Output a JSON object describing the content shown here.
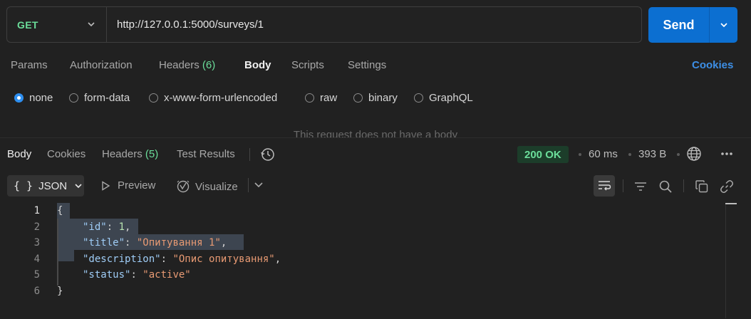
{
  "request": {
    "method": "GET",
    "url": "http://127.0.0.1:5000/surveys/1",
    "send_label": "Send"
  },
  "request_tabs": [
    {
      "label": "Params"
    },
    {
      "label": "Authorization"
    },
    {
      "label": "Headers",
      "count": "(6)"
    },
    {
      "label": "Body"
    },
    {
      "label": "Scripts"
    },
    {
      "label": "Settings"
    }
  ],
  "active_request_tab": "Body",
  "cookies_label": "Cookies",
  "body_types": [
    "none",
    "form-data",
    "x-www-form-urlencoded",
    "raw",
    "binary",
    "GraphQL"
  ],
  "selected_body_type": "none",
  "no_body_message": "This request does not have a body",
  "response": {
    "tabs": [
      {
        "label": "Body"
      },
      {
        "label": "Cookies"
      },
      {
        "label": "Headers",
        "count": "(5)"
      },
      {
        "label": "Test Results"
      }
    ],
    "active_tab": "Body",
    "status": "200 OK",
    "time": "60 ms",
    "size": "393 B",
    "format": "JSON",
    "preview_label": "Preview",
    "visualize_label": "Visualize",
    "code_lines": [
      {
        "n": "1",
        "text": "{"
      },
      {
        "n": "2",
        "key": "\"id\"",
        "sep": ": ",
        "value": "1",
        "value_type": "number",
        "tail": ","
      },
      {
        "n": "3",
        "key": "\"title\"",
        "sep": ": ",
        "value": "\"Опитування 1\"",
        "value_type": "string",
        "tail": ","
      },
      {
        "n": "4",
        "key": "\"description\"",
        "sep": ": ",
        "value": "\"Опис опитування\"",
        "value_type": "string",
        "tail": ","
      },
      {
        "n": "5",
        "key": "\"status\"",
        "sep": ": ",
        "value": "\"active\"",
        "value_type": "string",
        "tail": ""
      },
      {
        "n": "6",
        "text": "}"
      }
    ]
  },
  "colors": {
    "accent": "#0c6fd1",
    "method_get": "#6bdd9a",
    "status_ok": "#6bdd9a",
    "link": "#3d8fe6",
    "json_key": "#9fcdf7",
    "json_string": "#e89a73"
  }
}
